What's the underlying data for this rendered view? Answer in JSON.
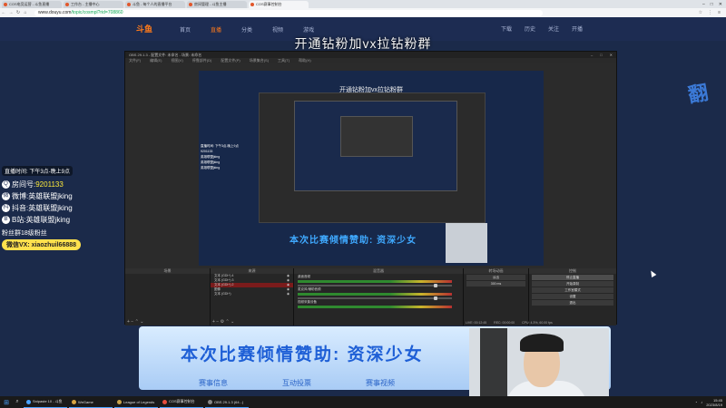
{
  "browser": {
    "tabs": [
      {
        "label": "COS电竞运营 - 斗鱼直播",
        "active": false
      },
      {
        "label": "工作台 - 主播中心",
        "active": false
      },
      {
        "label": "斗鱼 - 每个人的直播平台",
        "active": false
      },
      {
        "label": "房间管理 - 斗鱼主播",
        "active": true
      },
      {
        "label": "COS赛事控制台",
        "active": false
      }
    ],
    "url_host": "www.douyu.com",
    "url_path": "/topic/cosmpl?rid=708860"
  },
  "site": {
    "logo": "斗鱼",
    "nav": [
      "首页",
      "直播",
      "分类",
      "视频",
      "游戏"
    ],
    "header_right": [
      "下载",
      "历史",
      "关注",
      "开播"
    ]
  },
  "stream_title": "开通钻粉加vx拉钻粉群",
  "obs": {
    "title": "OBS 29.1.3 - 配置文件: 未命名 - 场景: 未命名",
    "menu": [
      "文件(F)",
      "编辑(E)",
      "视图(V)",
      "停靠部件(D)",
      "配置文件(P)",
      "场景集合(S)",
      "工具(T)",
      "帮助(H)"
    ],
    "preview_title": "开通钻粉加vx拉钻粉群",
    "preview_banner": "本次比赛倾情赞助: 资深少女",
    "docks": {
      "scenes": "场景",
      "sources": "来源",
      "mixer": "混音器",
      "transitions": "转场动画",
      "controls": "控制"
    },
    "sources": [
      {
        "name": "文本 (GDI+) 4",
        "selected": false
      },
      {
        "name": "文本 (GDI+) 3",
        "selected": false
      },
      {
        "name": "文本 (GDI+) 2",
        "selected": true
      },
      {
        "name": "图像",
        "selected": false
      },
      {
        "name": "文本 (GDI+)",
        "selected": false
      }
    ],
    "mixer_channels": [
      "桌面音频",
      "麦克风/辅助音频",
      "视频采集设备"
    ],
    "transition_value": "淡出",
    "transition_duration": "300 ms",
    "controls": [
      "停止直播",
      "开始录制",
      "工作室模式",
      "设置",
      "退出"
    ],
    "status": [
      "LIVE: 00:12:45",
      "REC: 00:00:00",
      "CPU: 4.3%, 60.00 fps"
    ]
  },
  "overlay": {
    "head": "直播时间: 下午3点-晚上9点",
    "lines": [
      {
        "icon": "Q",
        "label": "房间号:",
        "value": "9201133"
      },
      {
        "icon": "微",
        "label": "微博:",
        "value": "英雄联盟jking"
      },
      {
        "icon": "抖",
        "label": "抖音:",
        "value": "英雄联盟jking"
      },
      {
        "icon": "B",
        "label": "B站:",
        "value": "英雄联盟jking"
      }
    ],
    "section": "粉丝群18级粉丝",
    "wechat": "微信VX: xiaozhuil66888"
  },
  "page_banner": {
    "text": "本次比赛倾情赞助: 资深少女",
    "tabs": [
      "赛事信息",
      "互动投票",
      "赛事视频"
    ]
  },
  "right_deco": "翻",
  "taskbar": {
    "items": [
      {
        "label": "Snipaste 10 - 斗鱼",
        "color": "#4aa3ff"
      },
      {
        "label": "WeGame",
        "color": "#d9a441"
      },
      {
        "label": "League of Legends",
        "color": "#c9a34a"
      },
      {
        "label": "COS赛事控制台",
        "color": "#e84d3c"
      },
      {
        "label": "OBS 29.1.3 (64...)",
        "color": "#888888"
      }
    ],
    "time": "15:45",
    "date": "2023/8/19"
  }
}
